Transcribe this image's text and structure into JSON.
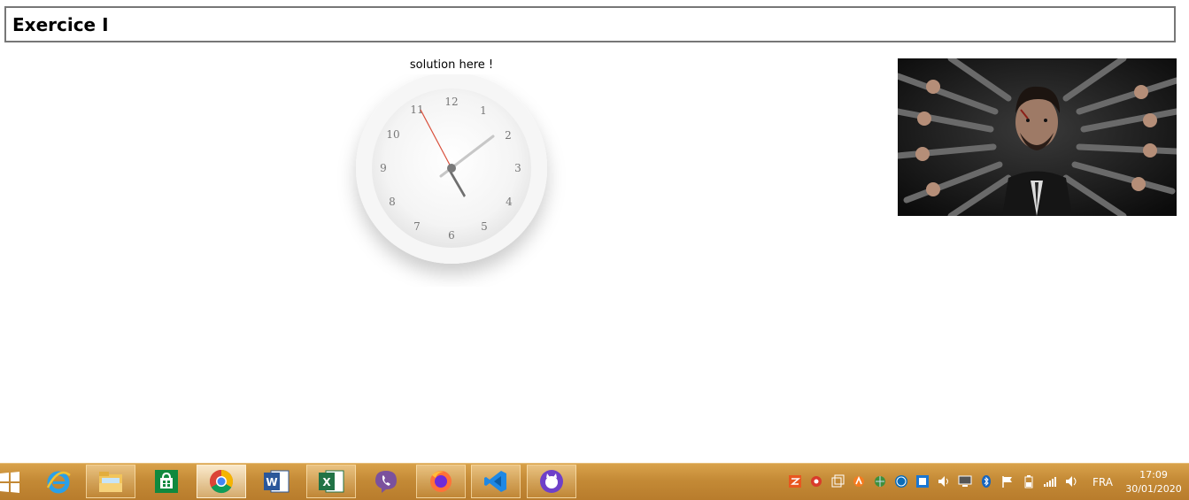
{
  "header": {
    "title": "Exercice I"
  },
  "main": {
    "solution_text": "solution here !",
    "clock": {
      "numbers": [
        "12",
        "1",
        "2",
        "3",
        "4",
        "5",
        "6",
        "7",
        "8",
        "9",
        "10",
        "11"
      ]
    },
    "image": {
      "description_name": "poster-image"
    }
  },
  "taskbar": {
    "apps": [
      "Internet Explorer",
      "File Explorer",
      "Store",
      "Chrome",
      "Word",
      "Excel",
      "Viber",
      "Firefox",
      "Visual Studio Code",
      "GitHub Desktop"
    ],
    "language": "FRA",
    "time": "17:09",
    "date": "30/01/2020"
  }
}
